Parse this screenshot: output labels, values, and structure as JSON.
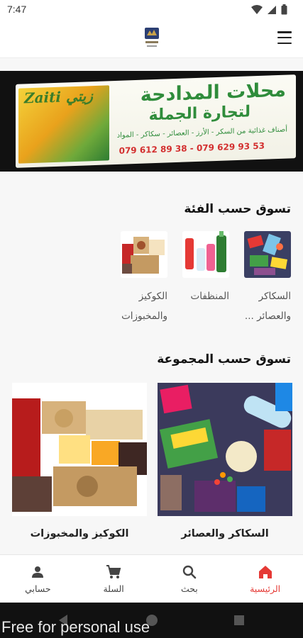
{
  "status_bar": {
    "time": "7:47",
    "icons": [
      "wifi-icon",
      "signal-icon",
      "battery-icon"
    ]
  },
  "app_bar": {
    "logo_icon": "store-logo-icon",
    "menu_icon": "hamburger-menu-icon"
  },
  "banner": {
    "brand": "Zaiti زيتي",
    "title": "محلات المدادحة",
    "subtitle": "لتجارة الجملة",
    "line": "أصناف غذائية من السكر - الأرز - العصائر - سكاكر - المواد",
    "phones": "079 612 89 38 - 079 629 93 53"
  },
  "categories": {
    "title": "تسوق حسب الفئة",
    "items": [
      {
        "label": "السكاكر والعصائر ..."
      },
      {
        "label": "المنظفات"
      },
      {
        "label": "الكوكيز والمخبوزات"
      }
    ]
  },
  "groups": {
    "title": "تسوق حسب المجموعة",
    "items": [
      {
        "label": "السكاكر والعصائر"
      },
      {
        "label": "الكوكيز والمخبوزات"
      }
    ]
  },
  "bottom_nav": {
    "items": [
      {
        "label": "الرئيسية",
        "icon": "home-icon",
        "active": true
      },
      {
        "label": "بحث",
        "icon": "search-icon",
        "active": false
      },
      {
        "label": "السلة",
        "icon": "cart-icon",
        "active": false
      },
      {
        "label": "حسابي",
        "icon": "account-icon",
        "active": false
      }
    ]
  },
  "colors": {
    "accent": "#e53935",
    "brand_green": "#2f8c3b"
  },
  "watermark": "Free for personal use"
}
